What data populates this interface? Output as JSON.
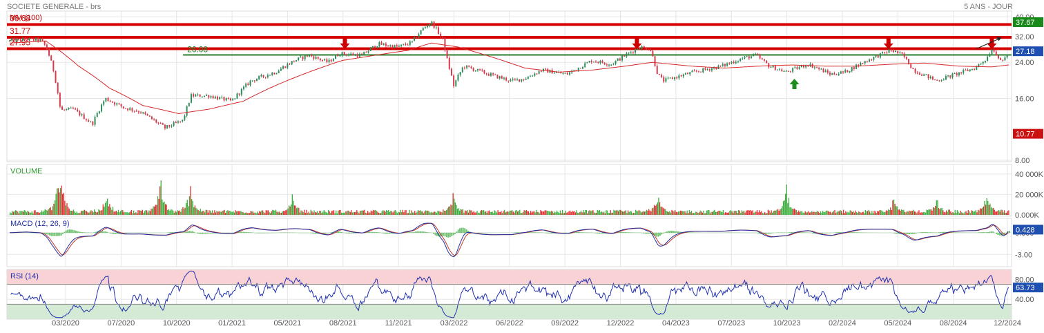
{
  "header": {
    "title": "SOCIETE GENERALE - brs",
    "period": "5 ANS - JOUR"
  },
  "colors": {
    "up": "#2e8b57",
    "down": "#d63a4a",
    "resistance": "#d40000",
    "support": "#2a7d2a",
    "ma": "#d62728",
    "macd": "#1f2f9e",
    "signal": "#c0392b",
    "rsi": "#1f2fb0",
    "volume_up": "#3cae3c",
    "volume_down": "#e03030",
    "histogram": "#5cb85c",
    "current_badge": "#1f4fb0",
    "high_badge": "#178a17",
    "low_badge": "#cc1111"
  },
  "chart_data": [
    {
      "type": "candlestick",
      "name": "price",
      "indicator_label": "MM (100)",
      "x_range": [
        "2019-12-16",
        "2024-12-16"
      ],
      "y_scale": "log",
      "ylim": [
        8,
        42
      ],
      "y_ticks": [
        "8.00",
        "16.00",
        "24.00",
        "32.00",
        "40.00"
      ],
      "x_ticks": [
        "03/2020",
        "07/2020",
        "10/2020",
        "01/2021",
        "05/2021",
        "08/2021",
        "11/2021",
        "03/2022",
        "06/2022",
        "09/2022",
        "12/2022",
        "04/2023",
        "07/2023",
        "10/2023",
        "02/2024",
        "05/2024",
        "08/2024",
        "12/2024"
      ],
      "price_path": [
        [
          "2019-12-16",
          30.5
        ],
        [
          "2020-01-15",
          31.0
        ],
        [
          "2020-02-10",
          30.8
        ],
        [
          "2020-02-21",
          28.5
        ],
        [
          "2020-03-05",
          22.0
        ],
        [
          "2020-03-18",
          14.0
        ],
        [
          "2020-04-10",
          14.2
        ],
        [
          "2020-05-15",
          12.0
        ],
        [
          "2020-06-08",
          16.0
        ],
        [
          "2020-07-10",
          14.5
        ],
        [
          "2020-08-10",
          13.8
        ],
        [
          "2020-09-25",
          11.5
        ],
        [
          "2020-10-28",
          12.5
        ],
        [
          "2020-11-12",
          16.5
        ],
        [
          "2020-12-15",
          16.5
        ],
        [
          "2021-01-25",
          15.5
        ],
        [
          "2021-03-01",
          19.5
        ],
        [
          "2021-04-15",
          21.5
        ],
        [
          "2021-05-20",
          24.5
        ],
        [
          "2021-06-15",
          26.0
        ],
        [
          "2021-07-20",
          24.0
        ],
        [
          "2021-08-10",
          26.5
        ],
        [
          "2021-09-20",
          26.0
        ],
        [
          "2021-10-20",
          29.5
        ],
        [
          "2021-11-25",
          28.5
        ],
        [
          "2021-12-20",
          30.0
        ],
        [
          "2022-01-10",
          35.0
        ],
        [
          "2022-01-25",
          37.67
        ],
        [
          "2022-02-15",
          31.0
        ],
        [
          "2022-02-24",
          24.0
        ],
        [
          "2022-03-07",
          18.5
        ],
        [
          "2022-03-25",
          23.0
        ],
        [
          "2022-05-10",
          21.0
        ],
        [
          "2022-06-20",
          19.5
        ],
        [
          "2022-07-15",
          20.0
        ],
        [
          "2022-08-15",
          22.0
        ],
        [
          "2022-09-30",
          21.0
        ],
        [
          "2022-11-15",
          24.5
        ],
        [
          "2022-12-20",
          23.5
        ],
        [
          "2023-02-10",
          28.5
        ],
        [
          "2023-03-01",
          28.0
        ],
        [
          "2023-03-15",
          21.0
        ],
        [
          "2023-03-25",
          19.5
        ],
        [
          "2023-05-20",
          21.5
        ],
        [
          "2023-07-10",
          23.0
        ],
        [
          "2023-08-15",
          25.0
        ],
        [
          "2023-09-10",
          26.0
        ],
        [
          "2023-10-05",
          23.0
        ],
        [
          "2023-11-05",
          21.5
        ],
        [
          "2023-12-15",
          23.5
        ],
        [
          "2024-01-25",
          21.0
        ],
        [
          "2024-02-20",
          21.5
        ],
        [
          "2024-03-25",
          24.0
        ],
        [
          "2024-04-15",
          25.5
        ],
        [
          "2024-05-15",
          27.5
        ],
        [
          "2024-06-05",
          26.0
        ],
        [
          "2024-06-25",
          22.0
        ],
        [
          "2024-08-05",
          19.5
        ],
        [
          "2024-09-10",
          21.0
        ],
        [
          "2024-10-15",
          22.5
        ],
        [
          "2024-11-05",
          25.0
        ],
        [
          "2024-11-15",
          28.0
        ],
        [
          "2024-12-05",
          24.0
        ],
        [
          "2024-12-16",
          27.18
        ]
      ],
      "moving_average_path": [
        [
          "2019-12-16",
          29.8
        ],
        [
          "2020-02-20",
          30.5
        ],
        [
          "2020-04-20",
          23.0
        ],
        [
          "2020-06-15",
          18.0
        ],
        [
          "2020-08-15",
          14.8
        ],
        [
          "2020-10-20",
          13.5
        ],
        [
          "2020-12-15",
          14.2
        ],
        [
          "2021-02-15",
          15.5
        ],
        [
          "2021-04-15",
          18.5
        ],
        [
          "2021-06-15",
          21.5
        ],
        [
          "2021-08-15",
          24.5
        ],
        [
          "2021-10-15",
          26.0
        ],
        [
          "2021-12-15",
          27.5
        ],
        [
          "2022-01-25",
          29.8
        ],
        [
          "2022-03-15",
          28.5
        ],
        [
          "2022-05-15",
          25.5
        ],
        [
          "2022-07-15",
          22.5
        ],
        [
          "2022-09-15",
          21.5
        ],
        [
          "2022-11-15",
          22.0
        ],
        [
          "2023-01-15",
          23.0
        ],
        [
          "2023-03-05",
          24.0
        ],
        [
          "2023-05-15",
          23.0
        ],
        [
          "2023-07-15",
          22.5
        ],
        [
          "2023-09-15",
          23.0
        ],
        [
          "2023-11-15",
          23.3
        ],
        [
          "2024-01-15",
          23.0
        ],
        [
          "2024-03-15",
          23.0
        ],
        [
          "2024-05-15",
          23.5
        ],
        [
          "2024-07-15",
          23.8
        ],
        [
          "2024-09-15",
          23.0
        ],
        [
          "2024-11-15",
          22.8
        ],
        [
          "2024-12-16",
          23.3
        ]
      ],
      "resistance_lines": [
        {
          "label": "36.68",
          "value": 36.68
        },
        {
          "label": "31.77",
          "value": 31.77
        },
        {
          "label": "27.95",
          "value": 27.95
        }
      ],
      "support_line": {
        "label": "26.08",
        "value": 26.08,
        "from": "2020-10-28"
      },
      "markers": [
        {
          "type": "down-arrow",
          "date": "2021-08-20",
          "value": 28.5
        },
        {
          "type": "down-arrow",
          "date": "2023-02-05",
          "value": 28.5
        },
        {
          "type": "up-arrow",
          "date": "2023-11-20",
          "value": 19.5
        },
        {
          "type": "down-arrow",
          "date": "2024-05-10",
          "value": 28.5
        },
        {
          "type": "down-arrow",
          "date": "2024-11-15",
          "value": 28.5
        }
      ],
      "badges": [
        {
          "label": "37.67",
          "value": 37.67,
          "kind": "high"
        },
        {
          "label": "27.18",
          "value": 27.18,
          "kind": "current"
        },
        {
          "label": "10.77",
          "value": 10.77,
          "kind": "low"
        }
      ]
    },
    {
      "type": "bar",
      "name": "volume",
      "indicator_label": "VOLUME",
      "ylim": [
        0,
        48000
      ],
      "y_ticks": [
        "0.000K",
        "20 000K",
        "40 000K"
      ],
      "spikes": [
        [
          "2020-03-12",
          28000
        ],
        [
          "2020-03-20",
          30000
        ],
        [
          "2020-06-10",
          22000
        ],
        [
          "2020-09-15",
          43000
        ],
        [
          "2020-11-10",
          32000
        ],
        [
          "2021-05-15",
          16000
        ],
        [
          "2022-03-05",
          18000
        ],
        [
          "2023-03-15",
          24000
        ],
        [
          "2023-11-05",
          28000
        ],
        [
          "2024-05-20",
          16000
        ],
        [
          "2024-08-05",
          14000
        ],
        [
          "2024-11-05",
          20000
        ]
      ]
    },
    {
      "type": "line",
      "name": "macd",
      "indicator_label": "MACD (12, 26, 9)",
      "ylim": [
        -4.5,
        1.8
      ],
      "y_ticks": [
        "-3.00",
        "0.000"
      ],
      "current": {
        "label": "0.428",
        "value": 0.428
      }
    },
    {
      "type": "line",
      "name": "rsi",
      "indicator_label": "RSI (14)",
      "ylim": [
        0,
        100
      ],
      "y_ticks": [
        "40.00",
        "80.00"
      ],
      "overbought": 70,
      "oversold": 30,
      "current": {
        "label": "63.73",
        "value": 63.73
      }
    }
  ]
}
